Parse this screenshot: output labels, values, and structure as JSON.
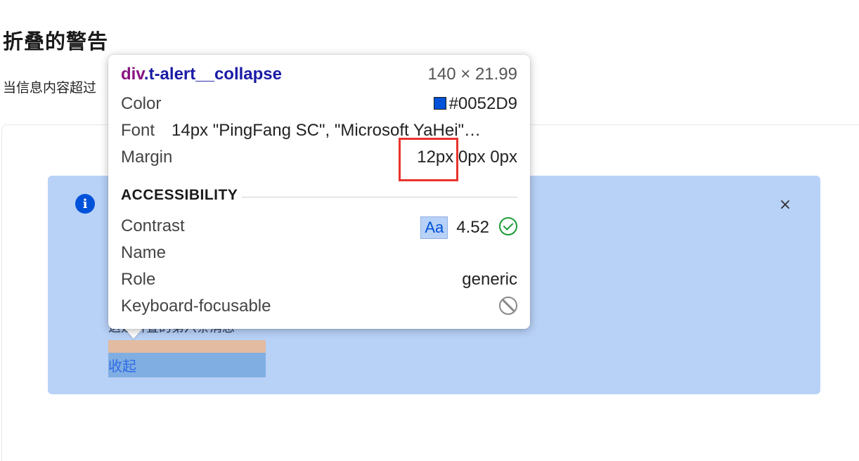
{
  "page": {
    "title": "折叠的警告",
    "description": "当信息内容超过"
  },
  "alert": {
    "message_partial": "这是折叠的第六条消息",
    "collapse_label": "收起",
    "info_icon": "i",
    "close_icon": "×"
  },
  "inspector": {
    "selector_tag": "div",
    "selector_class": ".t-alert__collapse",
    "size": "140 × 21.99",
    "color_label": "Color",
    "color_value": "#0052D9",
    "font_label": "Font",
    "font_value": "14px \"PingFang SC\", \"Microsoft YaHei\"…",
    "margin_label": "Margin",
    "margin_value": "12px 0px 0px",
    "accessibility_heading": "ACCESSIBILITY",
    "contrast_label": "Contrast",
    "contrast_badge": "Aa",
    "contrast_value": "4.52",
    "name_label": "Name",
    "role_label": "Role",
    "role_value": "generic",
    "focusable_label": "Keyboard-focusable"
  },
  "colors": {
    "brand": "#0052D9",
    "alert_bg": "#b8d1f7",
    "highlight_margin": "#e2bba1",
    "highlight_content": "#80aee2",
    "annotation_red": "#e8332b"
  },
  "icons": [
    "info-icon",
    "close-icon",
    "check-icon",
    "ban-icon"
  ]
}
